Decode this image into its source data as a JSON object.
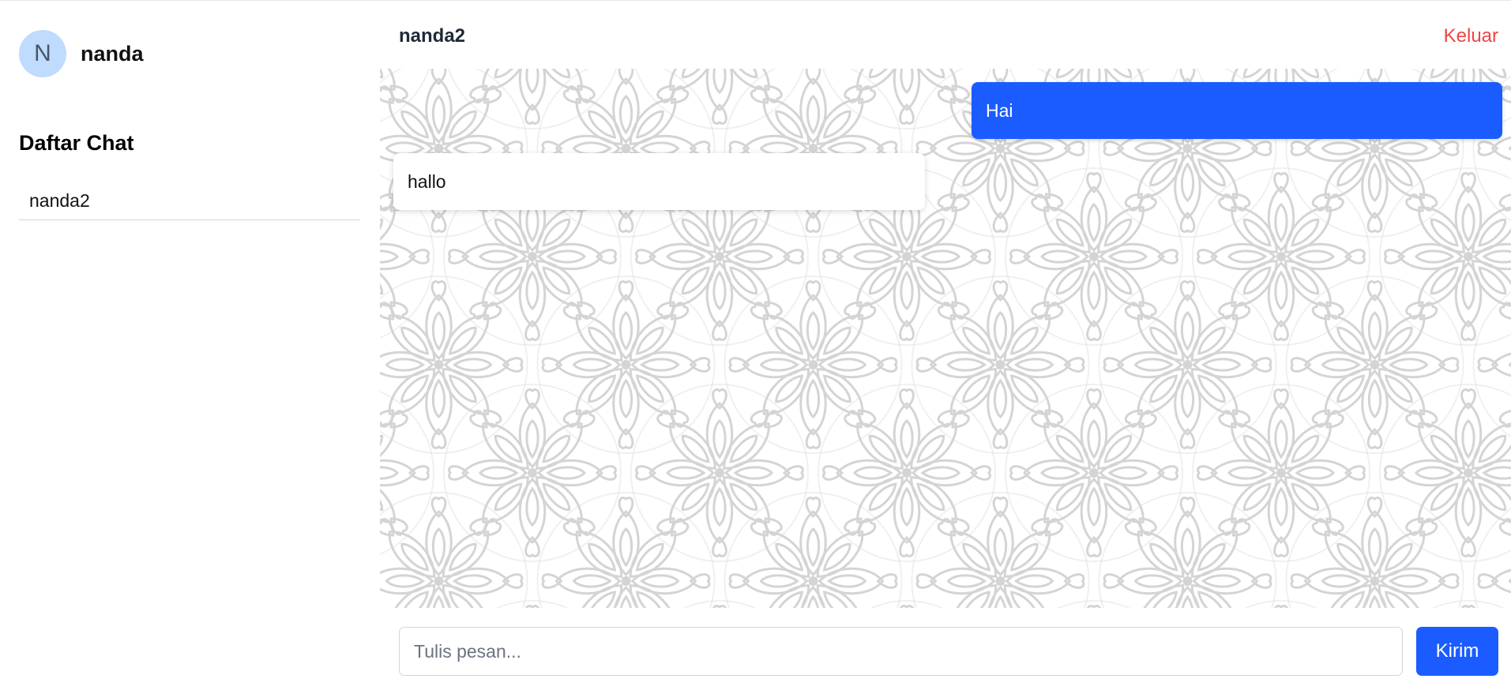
{
  "user": {
    "avatar_initial": "N",
    "name": "nanda"
  },
  "sidebar": {
    "title": "Daftar Chat",
    "chats": [
      {
        "name": "nanda2"
      }
    ]
  },
  "chat": {
    "contact_name": "nanda2",
    "logout_label": "Keluar",
    "messages": [
      {
        "direction": "outgoing",
        "text": "Hai"
      },
      {
        "direction": "incoming",
        "text": "hallo"
      }
    ]
  },
  "composer": {
    "placeholder": "Tulis pesan...",
    "value": "",
    "send_label": "Kirim"
  },
  "colors": {
    "accent": "#1a5cff",
    "logout": "#ef4444",
    "avatar_bg": "#bfdbfe",
    "pattern": "#d4d4d4"
  }
}
